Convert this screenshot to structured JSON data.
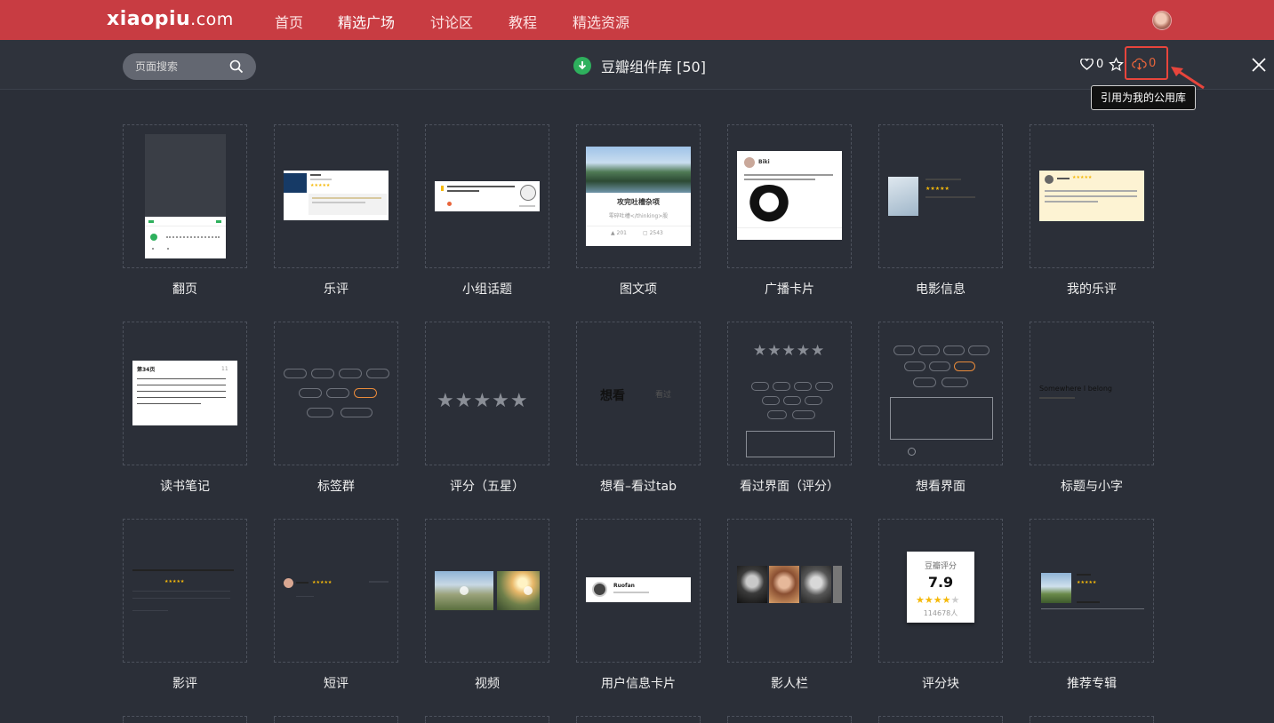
{
  "nav": {
    "logo": "xiaopiu",
    "logo_suffix": ".com",
    "items": [
      "首页",
      "精选广场",
      "讨论区",
      "教程",
      "精选资源"
    ],
    "active_index": 1
  },
  "toolbar": {
    "search_placeholder": "页面搜索",
    "library_title": "豆瓣组件库 [50]",
    "like_count": "0",
    "cite_count": "0",
    "tooltip": "引用为我的公用库"
  },
  "components": [
    "翻页",
    "乐评",
    "小组话题",
    "图文项",
    "广播卡片",
    "电影信息",
    "我的乐评",
    "读书笔记",
    "标签群",
    "评分（五星）",
    "想看–看过tab",
    "看过界面（评分）",
    "想看界面",
    "标题与小字",
    "影评",
    "短评",
    "视频",
    "用户信息卡片",
    "影人栏",
    "评分块",
    "推荐专辑"
  ],
  "previews": {
    "image_text_title": "攻完吐槽杂项",
    "image_text_sub": "零碎吐槽</thinking>股",
    "image_text_likes": "201",
    "image_text_comments": "2543",
    "broadcast_user": "Biki",
    "reading_title": "第34页",
    "reading_count": "11",
    "want_see": "想看",
    "seen": "看过",
    "title_small": "Somewhere I belong",
    "user_card_name": "Ruofan",
    "rating_block_label": "豆瓣评分",
    "rating_block_score": "7.9",
    "rating_block_count": "114678人",
    "rating_block_stars": 4
  },
  "colors": {
    "nav_bg": "#c83c42",
    "page_bg": "#2b2f38",
    "accent_green": "#2eb05d",
    "highlight_red": "#e8453c",
    "star_yellow": "#f5b90a"
  }
}
